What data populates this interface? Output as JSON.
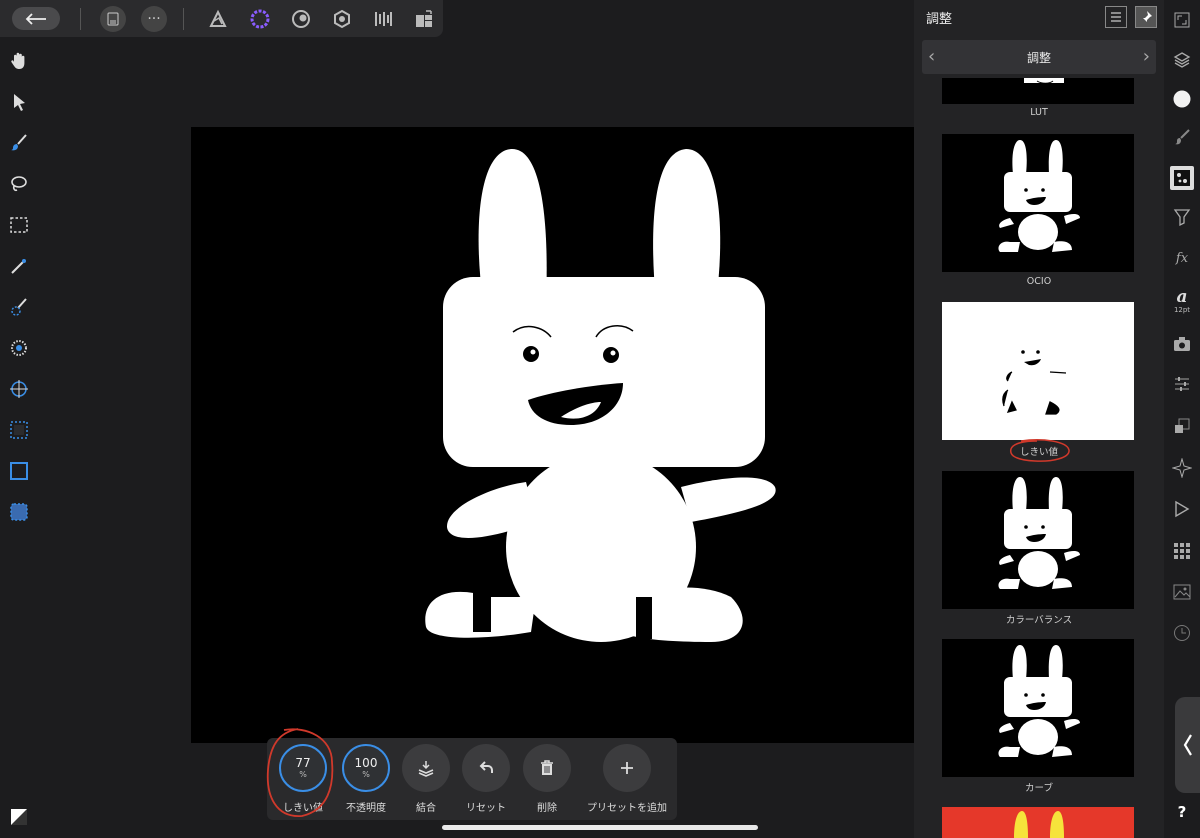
{
  "top_toolbar": {
    "back_label": "back",
    "more_label": "···"
  },
  "panel": {
    "title": "調整",
    "sub_title": "調整",
    "thumbnails": [
      {
        "label": "LUT"
      },
      {
        "label": "OCIO"
      },
      {
        "label": "しきい値",
        "highlighted": true
      },
      {
        "label": "カラーバランス"
      },
      {
        "label": "カーブ"
      }
    ]
  },
  "context_toolbar": {
    "threshold": {
      "value": "77",
      "unit": "%",
      "label": "しきい値"
    },
    "opacity": {
      "value": "100",
      "unit": "%",
      "label": "不透明度"
    },
    "merge_label": "結合",
    "reset_label": "リセット",
    "delete_label": "削除",
    "add_preset_label": "プリセットを追加"
  },
  "right_bar": {
    "font_size_label": "12pt",
    "help_label": "?"
  },
  "colors": {
    "accent": "#3a8ee6",
    "annotation": "#d0392b",
    "panel_bg": "#232325"
  }
}
